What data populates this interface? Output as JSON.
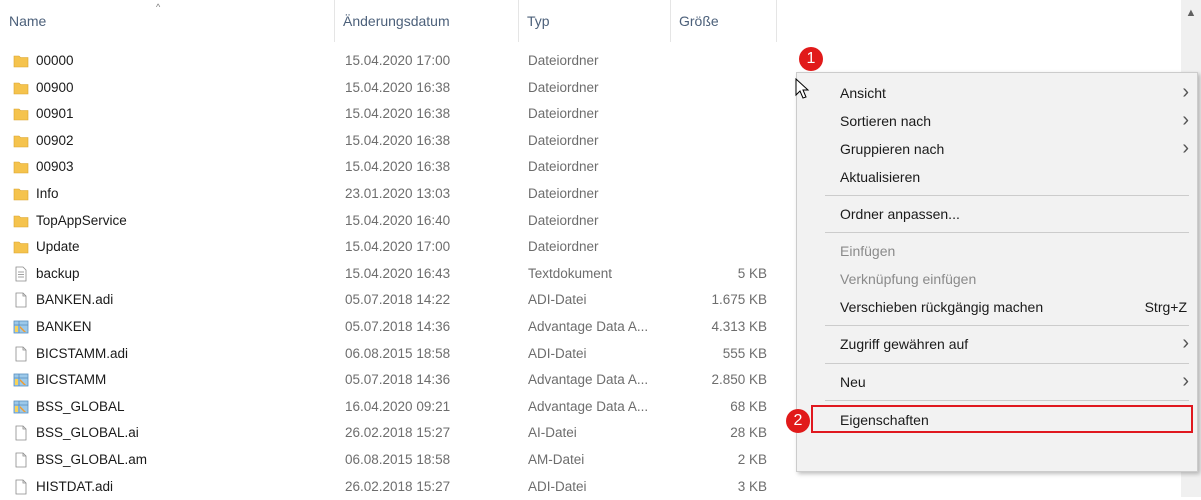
{
  "header": {
    "name": "Name",
    "date": "Änderungsdatum",
    "type": "Typ",
    "size": "Größe",
    "sort_indicator": "^"
  },
  "files": [
    {
      "icon": "folder",
      "name": "00000",
      "date": "15.04.2020 17:00",
      "type": "Dateiordner",
      "size": ""
    },
    {
      "icon": "folder",
      "name": "00900",
      "date": "15.04.2020 16:38",
      "type": "Dateiordner",
      "size": ""
    },
    {
      "icon": "folder",
      "name": "00901",
      "date": "15.04.2020 16:38",
      "type": "Dateiordner",
      "size": ""
    },
    {
      "icon": "folder",
      "name": "00902",
      "date": "15.04.2020 16:38",
      "type": "Dateiordner",
      "size": ""
    },
    {
      "icon": "folder",
      "name": "00903",
      "date": "15.04.2020 16:38",
      "type": "Dateiordner",
      "size": ""
    },
    {
      "icon": "folder",
      "name": "Info",
      "date": "23.01.2020 13:03",
      "type": "Dateiordner",
      "size": ""
    },
    {
      "icon": "folder",
      "name": "TopAppService",
      "date": "15.04.2020 16:40",
      "type": "Dateiordner",
      "size": ""
    },
    {
      "icon": "folder",
      "name": "Update",
      "date": "15.04.2020 17:00",
      "type": "Dateiordner",
      "size": ""
    },
    {
      "icon": "text",
      "name": "backup",
      "date": "15.04.2020 16:43",
      "type": "Textdokument",
      "size": "5 KB"
    },
    {
      "icon": "file",
      "name": "BANKEN.adi",
      "date": "05.07.2018 14:22",
      "type": "ADI-Datei",
      "size": "1.675 KB"
    },
    {
      "icon": "table",
      "name": "BANKEN",
      "date": "05.07.2018 14:36",
      "type": "Advantage Data A...",
      "size": "4.313 KB"
    },
    {
      "icon": "file",
      "name": "BICSTAMM.adi",
      "date": "06.08.2015 18:58",
      "type": "ADI-Datei",
      "size": "555 KB"
    },
    {
      "icon": "table",
      "name": "BICSTAMM",
      "date": "05.07.2018 14:36",
      "type": "Advantage Data A...",
      "size": "2.850 KB"
    },
    {
      "icon": "table",
      "name": "BSS_GLOBAL",
      "date": "16.04.2020 09:21",
      "type": "Advantage Data A...",
      "size": "68 KB"
    },
    {
      "icon": "file",
      "name": "BSS_GLOBAL.ai",
      "date": "26.02.2018 15:27",
      "type": "AI-Datei",
      "size": "28 KB"
    },
    {
      "icon": "file",
      "name": "BSS_GLOBAL.am",
      "date": "06.08.2015 18:58",
      "type": "AM-Datei",
      "size": "2 KB"
    },
    {
      "icon": "file",
      "name": "HISTDAT.adi",
      "date": "26.02.2018 15:27",
      "type": "ADI-Datei",
      "size": "3 KB"
    }
  ],
  "context_menu": {
    "items": [
      {
        "label": "Ansicht",
        "submenu": true,
        "disabled": false,
        "shortcut": ""
      },
      {
        "label": "Sortieren nach",
        "submenu": true,
        "disabled": false,
        "shortcut": ""
      },
      {
        "label": "Gruppieren nach",
        "submenu": true,
        "disabled": false,
        "shortcut": ""
      },
      {
        "label": "Aktualisieren",
        "submenu": false,
        "disabled": false,
        "shortcut": ""
      },
      {
        "label": "Ordner anpassen...",
        "submenu": false,
        "disabled": false,
        "shortcut": ""
      },
      {
        "label": "Einfügen",
        "submenu": false,
        "disabled": true,
        "shortcut": ""
      },
      {
        "label": "Verknüpfung einfügen",
        "submenu": false,
        "disabled": true,
        "shortcut": ""
      },
      {
        "label": "Verschieben rückgängig machen",
        "submenu": false,
        "disabled": false,
        "shortcut": "Strg+Z"
      },
      {
        "label": "Zugriff gewähren auf",
        "submenu": true,
        "disabled": false,
        "shortcut": ""
      },
      {
        "label": "Neu",
        "submenu": true,
        "disabled": false,
        "shortcut": ""
      },
      {
        "label": "Eigenschaften",
        "submenu": false,
        "disabled": false,
        "shortcut": ""
      }
    ],
    "arrow_glyph": "›"
  },
  "annotations": {
    "badge_1": "1",
    "badge_2": "2",
    "highlight_color": "#e0181f"
  },
  "colors": {
    "folder": "#f5c34d",
    "header_text": "#4c607a",
    "menu_bg": "#f2f2f2"
  }
}
